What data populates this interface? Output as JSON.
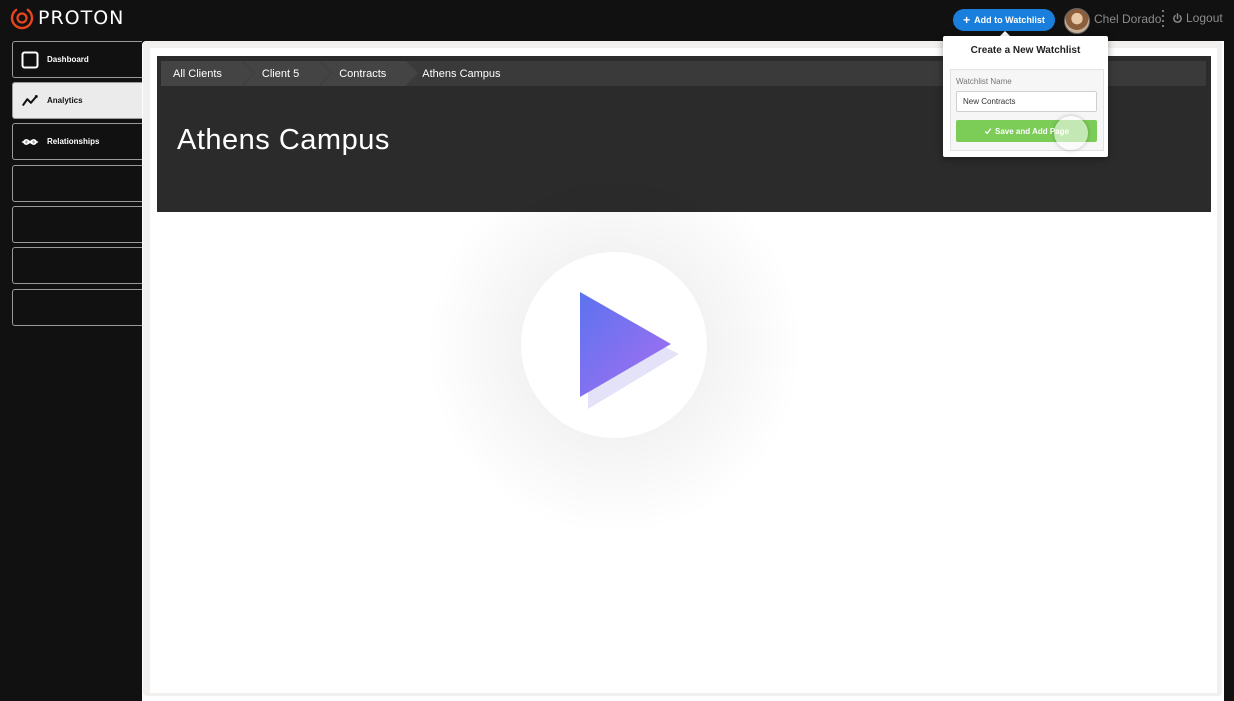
{
  "brand": {
    "name": "PROTON",
    "accent": "#e8451e"
  },
  "topbar": {
    "add_watchlist_label": "Add to Watchlist",
    "add_watchlist_icon": "plus-icon",
    "user_name": "Chel Dorado",
    "logout_label": "Logout",
    "logout_icon": "power-icon",
    "button_color": "#1a7fdc"
  },
  "sidebar": {
    "items": [
      {
        "label": "Dashboard",
        "icon": "square-icon",
        "active": false
      },
      {
        "label": "Analytics",
        "icon": "trend-line-icon",
        "active": true
      },
      {
        "label": "Relationships",
        "icon": "dna-icon",
        "active": false
      },
      {
        "label": "",
        "icon": "",
        "active": false
      },
      {
        "label": "",
        "icon": "",
        "active": false
      },
      {
        "label": "",
        "icon": "",
        "active": false
      },
      {
        "label": "",
        "icon": "",
        "active": false
      }
    ]
  },
  "breadcrumb": [
    "All Clients",
    "Client 5",
    "Contracts",
    "Athens Campus"
  ],
  "page": {
    "title": "Athens Campus"
  },
  "player": {
    "icon": "play-icon",
    "gradient": [
      "#5b73f0",
      "#a86ff0"
    ]
  },
  "watchlist_popover": {
    "title": "Create a New Watchlist",
    "name_label": "Watchlist Name",
    "name_value": "New Contracts",
    "save_label": "Save and Add Page",
    "save_icon": "check-icon",
    "save_color": "#7ccc58"
  }
}
